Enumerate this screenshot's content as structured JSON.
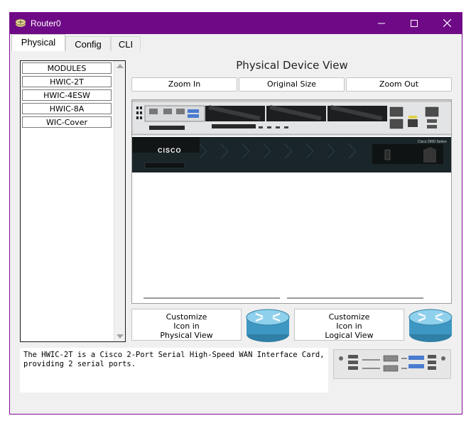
{
  "window": {
    "title": "Router0",
    "minimize": "─",
    "maximize": "☐",
    "close": "✕",
    "titlebar_color": "#6f0a86"
  },
  "tabs": [
    {
      "label": "Physical",
      "active": true
    },
    {
      "label": "Config",
      "active": false
    },
    {
      "label": "CLI",
      "active": false
    }
  ],
  "modules": {
    "items": [
      "MODULES",
      "HWIC-2T",
      "HWIC-4ESW",
      "HWIC-8A",
      "WIC-Cover"
    ]
  },
  "physical_view": {
    "title": "Physical Device View",
    "zoom_in": "Zoom In",
    "original_size": "Original Size",
    "zoom_out": "Zoom Out",
    "router_brand": "CISCO",
    "router_series": "Cisco 2900 Series"
  },
  "customize": {
    "physical": [
      "Customize",
      "Icon in",
      "Physical View"
    ],
    "logical": [
      "Customize",
      "Icon in",
      "Logical View"
    ]
  },
  "description": "The HWIC-2T is a Cisco 2-Port Serial High-Speed WAN Interface Card,\nproviding 2 serial ports."
}
